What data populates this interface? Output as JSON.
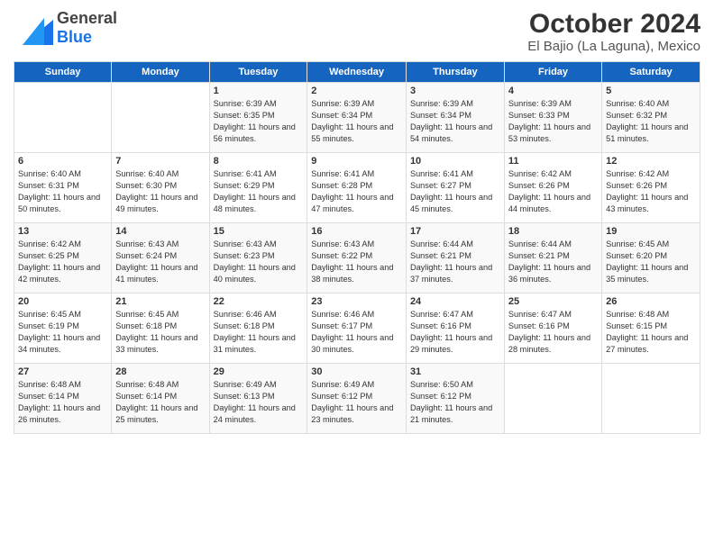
{
  "header": {
    "logo_general": "General",
    "logo_blue": "Blue",
    "title": "October 2024",
    "subtitle": "El Bajio (La Laguna), Mexico"
  },
  "weekdays": [
    "Sunday",
    "Monday",
    "Tuesday",
    "Wednesday",
    "Thursday",
    "Friday",
    "Saturday"
  ],
  "weeks": [
    [
      {
        "day": "",
        "sunrise": "",
        "sunset": "",
        "daylight": ""
      },
      {
        "day": "",
        "sunrise": "",
        "sunset": "",
        "daylight": ""
      },
      {
        "day": "1",
        "sunrise": "Sunrise: 6:39 AM",
        "sunset": "Sunset: 6:35 PM",
        "daylight": "Daylight: 11 hours and 56 minutes."
      },
      {
        "day": "2",
        "sunrise": "Sunrise: 6:39 AM",
        "sunset": "Sunset: 6:34 PM",
        "daylight": "Daylight: 11 hours and 55 minutes."
      },
      {
        "day": "3",
        "sunrise": "Sunrise: 6:39 AM",
        "sunset": "Sunset: 6:34 PM",
        "daylight": "Daylight: 11 hours and 54 minutes."
      },
      {
        "day": "4",
        "sunrise": "Sunrise: 6:39 AM",
        "sunset": "Sunset: 6:33 PM",
        "daylight": "Daylight: 11 hours and 53 minutes."
      },
      {
        "day": "5",
        "sunrise": "Sunrise: 6:40 AM",
        "sunset": "Sunset: 6:32 PM",
        "daylight": "Daylight: 11 hours and 51 minutes."
      }
    ],
    [
      {
        "day": "6",
        "sunrise": "Sunrise: 6:40 AM",
        "sunset": "Sunset: 6:31 PM",
        "daylight": "Daylight: 11 hours and 50 minutes."
      },
      {
        "day": "7",
        "sunrise": "Sunrise: 6:40 AM",
        "sunset": "Sunset: 6:30 PM",
        "daylight": "Daylight: 11 hours and 49 minutes."
      },
      {
        "day": "8",
        "sunrise": "Sunrise: 6:41 AM",
        "sunset": "Sunset: 6:29 PM",
        "daylight": "Daylight: 11 hours and 48 minutes."
      },
      {
        "day": "9",
        "sunrise": "Sunrise: 6:41 AM",
        "sunset": "Sunset: 6:28 PM",
        "daylight": "Daylight: 11 hours and 47 minutes."
      },
      {
        "day": "10",
        "sunrise": "Sunrise: 6:41 AM",
        "sunset": "Sunset: 6:27 PM",
        "daylight": "Daylight: 11 hours and 45 minutes."
      },
      {
        "day": "11",
        "sunrise": "Sunrise: 6:42 AM",
        "sunset": "Sunset: 6:26 PM",
        "daylight": "Daylight: 11 hours and 44 minutes."
      },
      {
        "day": "12",
        "sunrise": "Sunrise: 6:42 AM",
        "sunset": "Sunset: 6:26 PM",
        "daylight": "Daylight: 11 hours and 43 minutes."
      }
    ],
    [
      {
        "day": "13",
        "sunrise": "Sunrise: 6:42 AM",
        "sunset": "Sunset: 6:25 PM",
        "daylight": "Daylight: 11 hours and 42 minutes."
      },
      {
        "day": "14",
        "sunrise": "Sunrise: 6:43 AM",
        "sunset": "Sunset: 6:24 PM",
        "daylight": "Daylight: 11 hours and 41 minutes."
      },
      {
        "day": "15",
        "sunrise": "Sunrise: 6:43 AM",
        "sunset": "Sunset: 6:23 PM",
        "daylight": "Daylight: 11 hours and 40 minutes."
      },
      {
        "day": "16",
        "sunrise": "Sunrise: 6:43 AM",
        "sunset": "Sunset: 6:22 PM",
        "daylight": "Daylight: 11 hours and 38 minutes."
      },
      {
        "day": "17",
        "sunrise": "Sunrise: 6:44 AM",
        "sunset": "Sunset: 6:21 PM",
        "daylight": "Daylight: 11 hours and 37 minutes."
      },
      {
        "day": "18",
        "sunrise": "Sunrise: 6:44 AM",
        "sunset": "Sunset: 6:21 PM",
        "daylight": "Daylight: 11 hours and 36 minutes."
      },
      {
        "day": "19",
        "sunrise": "Sunrise: 6:45 AM",
        "sunset": "Sunset: 6:20 PM",
        "daylight": "Daylight: 11 hours and 35 minutes."
      }
    ],
    [
      {
        "day": "20",
        "sunrise": "Sunrise: 6:45 AM",
        "sunset": "Sunset: 6:19 PM",
        "daylight": "Daylight: 11 hours and 34 minutes."
      },
      {
        "day": "21",
        "sunrise": "Sunrise: 6:45 AM",
        "sunset": "Sunset: 6:18 PM",
        "daylight": "Daylight: 11 hours and 33 minutes."
      },
      {
        "day": "22",
        "sunrise": "Sunrise: 6:46 AM",
        "sunset": "Sunset: 6:18 PM",
        "daylight": "Daylight: 11 hours and 31 minutes."
      },
      {
        "day": "23",
        "sunrise": "Sunrise: 6:46 AM",
        "sunset": "Sunset: 6:17 PM",
        "daylight": "Daylight: 11 hours and 30 minutes."
      },
      {
        "day": "24",
        "sunrise": "Sunrise: 6:47 AM",
        "sunset": "Sunset: 6:16 PM",
        "daylight": "Daylight: 11 hours and 29 minutes."
      },
      {
        "day": "25",
        "sunrise": "Sunrise: 6:47 AM",
        "sunset": "Sunset: 6:16 PM",
        "daylight": "Daylight: 11 hours and 28 minutes."
      },
      {
        "day": "26",
        "sunrise": "Sunrise: 6:48 AM",
        "sunset": "Sunset: 6:15 PM",
        "daylight": "Daylight: 11 hours and 27 minutes."
      }
    ],
    [
      {
        "day": "27",
        "sunrise": "Sunrise: 6:48 AM",
        "sunset": "Sunset: 6:14 PM",
        "daylight": "Daylight: 11 hours and 26 minutes."
      },
      {
        "day": "28",
        "sunrise": "Sunrise: 6:48 AM",
        "sunset": "Sunset: 6:14 PM",
        "daylight": "Daylight: 11 hours and 25 minutes."
      },
      {
        "day": "29",
        "sunrise": "Sunrise: 6:49 AM",
        "sunset": "Sunset: 6:13 PM",
        "daylight": "Daylight: 11 hours and 24 minutes."
      },
      {
        "day": "30",
        "sunrise": "Sunrise: 6:49 AM",
        "sunset": "Sunset: 6:12 PM",
        "daylight": "Daylight: 11 hours and 23 minutes."
      },
      {
        "day": "31",
        "sunrise": "Sunrise: 6:50 AM",
        "sunset": "Sunset: 6:12 PM",
        "daylight": "Daylight: 11 hours and 21 minutes."
      },
      {
        "day": "",
        "sunrise": "",
        "sunset": "",
        "daylight": ""
      },
      {
        "day": "",
        "sunrise": "",
        "sunset": "",
        "daylight": ""
      }
    ]
  ]
}
